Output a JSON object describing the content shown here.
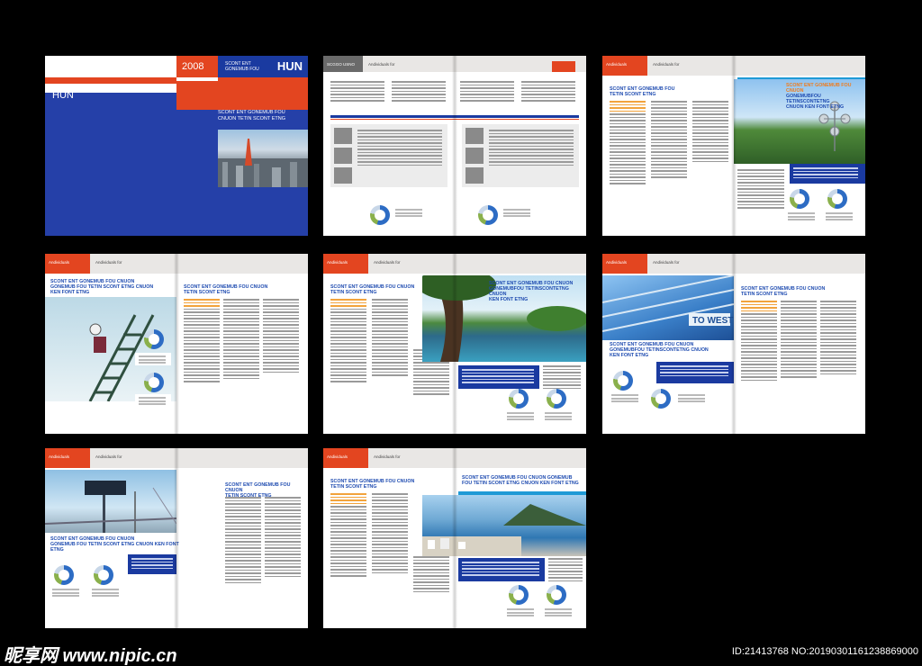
{
  "cover": {
    "hun_left": "HUN",
    "year": "2008",
    "subtitle_line1": "SCONT ENT",
    "subtitle_line2": "GONEMUB FOU",
    "hun_right": "HUN",
    "title_line1": "SCONT ENT GONEMUB FOU",
    "title_line2": "CNUON TETIN SCONT ETNG"
  },
  "spread2": {
    "header": "SCGGO USNO",
    "section": "Andividuals for"
  },
  "spread3": {
    "red_label": "Andividuals",
    "section": "Andividuals for",
    "headline1": "SCONT ENT GONEMUB FOU",
    "headline2": "TETIN SCONT ETNG",
    "headline_r1": "SCONT ENT GONEMUB FOU CNUON",
    "headline_r2": "GONEMUBFOU TETINSCONTETNG",
    "headline_r3": "CNUON KEN FONT ETNG"
  },
  "spread4": {
    "red_label": "Andividuals",
    "section": "Andividuals for",
    "headline1": "SCONT ENT GONEMUB FOU CNUON",
    "headline2": "GONEMUB FOU TETIN SCONT ETNG CNUON",
    "headline3": "KEN FONT ETNG",
    "headline_r1": "SCONT ENT GONEMUB FOU CNUON",
    "headline_r2": "TETIN SCONT ETNG"
  },
  "spread5": {
    "red_label": "Andividuals",
    "section": "Andividuals for",
    "headline1": "SCONT ENT GONEMUB FOU CNUON",
    "headline2": "TETIN SCONT ETNG",
    "headline_r1": "SCONT ENT GONEMUB FOU CNUON",
    "headline_r2": "GONEMUBFOU TETINSCONTETNG CNUON",
    "headline_r3": "KEN FONT ETNG"
  },
  "spread6": {
    "red_label": "Andividuals",
    "section": "Andividuals for",
    "headline1": "SCONT ENT GONEMUB FOU CNUON",
    "headline2": "GONEMUBFOU TETINSCONTETNG CNUON",
    "headline3": "KEN FONT ETNG",
    "sign": "TO WEST",
    "headline_r1": "SCONT ENT GONEMUB FOU CNUON",
    "headline_r2": "TETIN SCONT ETNG"
  },
  "spread7": {
    "red_label": "Andividuals",
    "section": "Andividuals for",
    "headline1": "SCONT ENT GONEMUB FOU CNUON",
    "headline2": "GONEMUB FOU TETIN SCONT ETNG CNUON KEN FONT",
    "headline3": "ETNG",
    "headline_r1": "SCONT ENT GONEMUB FOU CNUON",
    "headline_r2": "TETIN SCONT ETNG"
  },
  "spread8": {
    "red_label": "Andividuals",
    "section": "Andividuals for",
    "headline1": "SCONT ENT GONEMUB FOU CNUON",
    "headline2": "TETIN SCONT ETNG",
    "headline_r1": "SCONT ENT GONEMUB FOU CNUON GONEMUB",
    "headline_r2": "FOU TETIN SCONT ETNG CNUON KEN FONT ETNG"
  },
  "watermark": {
    "brand": "昵享网 www.nipic.cn",
    "id": "ID:21413768 NO:20190301161238869000"
  },
  "colors": {
    "blue": "#2540a8",
    "orange": "#e34520",
    "accent": "#f07b1c",
    "cyan": "#1e9ad6"
  }
}
